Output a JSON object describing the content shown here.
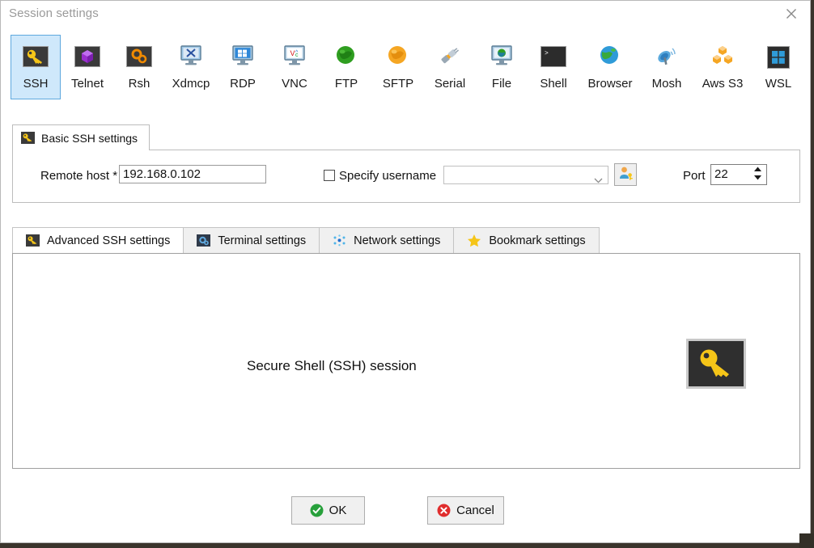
{
  "window": {
    "title": "Session settings",
    "close_icon": "close-icon"
  },
  "protocols": {
    "selected": "SSH",
    "items": [
      {
        "label": "SSH",
        "icon": "key-icon"
      },
      {
        "label": "Telnet",
        "icon": "gem-icon"
      },
      {
        "label": "Rsh",
        "icon": "gears-icon"
      },
      {
        "label": "Xdmcp",
        "icon": "monitor-x-icon"
      },
      {
        "label": "RDP",
        "icon": "monitor-windows-icon"
      },
      {
        "label": "VNC",
        "icon": "monitor-vc-icon"
      },
      {
        "label": "FTP",
        "icon": "green-globe-icon"
      },
      {
        "label": "SFTP",
        "icon": "orange-globe-icon"
      },
      {
        "label": "Serial",
        "icon": "plug-icon"
      },
      {
        "label": "File",
        "icon": "monitor-globe-icon"
      },
      {
        "label": "Shell",
        "icon": "terminal-icon"
      },
      {
        "label": "Browser",
        "icon": "blue-globe-icon"
      },
      {
        "label": "Mosh",
        "icon": "satellite-icon"
      },
      {
        "label": "Aws S3",
        "icon": "cubes-icon"
      },
      {
        "label": "WSL",
        "icon": "windows-icon"
      }
    ]
  },
  "basic": {
    "tab_label": "Basic SSH settings",
    "tab_icon": "key-icon",
    "remote_host_label": "Remote host *",
    "remote_host_value": "192.168.0.102",
    "remote_host_placeholder": "",
    "specify_username_label": "Specify username",
    "specify_username_checked": false,
    "username_value": "",
    "username_placeholder": "",
    "username_dropdown_icon": "chevron-down-icon",
    "user_key_button_icon": "user-key-icon",
    "port_label": "Port",
    "port_value": "22",
    "port_spinner_icon": "spinner-arrows-icon"
  },
  "lower_tabs": {
    "selected": "Advanced SSH settings",
    "items": [
      {
        "label": "Advanced SSH settings",
        "icon": "key-icon"
      },
      {
        "label": "Terminal settings",
        "icon": "gear-icon"
      },
      {
        "label": "Network settings",
        "icon": "network-dots-icon"
      },
      {
        "label": "Bookmark settings",
        "icon": "star-icon"
      }
    ]
  },
  "panel": {
    "description": "Secure Shell (SSH) session",
    "big_icon": "key-icon"
  },
  "footer": {
    "ok_label": "OK",
    "ok_icon": "check-circle-icon",
    "cancel_label": "Cancel",
    "cancel_icon": "x-circle-icon"
  },
  "colors": {
    "selection": "#cfe8fb",
    "selection_border": "#5ea8de",
    "key_yellow": "#f5c518",
    "ok_green": "#27a03b",
    "cancel_red": "#e02d2d"
  }
}
